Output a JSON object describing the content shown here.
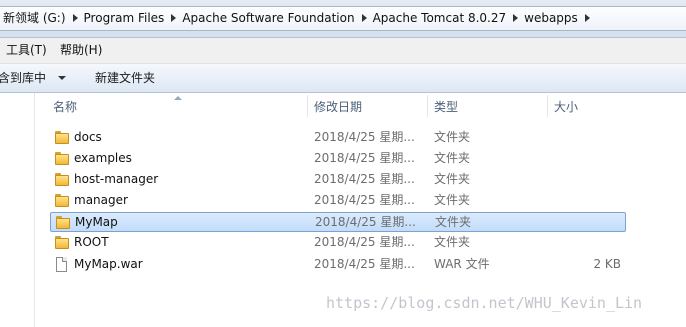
{
  "address": {
    "crumbs": [
      "新领域 (G:)",
      "Program Files",
      "Apache Software Foundation",
      "Apache Tomcat 8.0.27",
      "webapps"
    ]
  },
  "menu": {
    "tools": "工具(T)",
    "help": "帮助(H)"
  },
  "toolbar": {
    "include_library": "包含到库中",
    "new_folder": "新建文件夹"
  },
  "columns": {
    "name": "名称",
    "date": "修改日期",
    "type": "类型",
    "size": "大小"
  },
  "files": [
    {
      "name": "docs",
      "date": "2018/4/25 星期...",
      "type": "文件夹",
      "size": "",
      "icon": "folder-icon"
    },
    {
      "name": "examples",
      "date": "2018/4/25 星期...",
      "type": "文件夹",
      "size": "",
      "icon": "folder-icon"
    },
    {
      "name": "host-manager",
      "date": "2018/4/25 星期...",
      "type": "文件夹",
      "size": "",
      "icon": "folder-icon"
    },
    {
      "name": "manager",
      "date": "2018/4/25 星期...",
      "type": "文件夹",
      "size": "",
      "icon": "folder-icon"
    },
    {
      "name": "MyMap",
      "date": "2018/4/25 星期...",
      "type": "文件夹",
      "size": "",
      "icon": "folder-icon",
      "selected": true
    },
    {
      "name": "ROOT",
      "date": "2018/4/25 星期...",
      "type": "文件夹",
      "size": "",
      "icon": "folder-icon"
    },
    {
      "name": "MyMap.war",
      "date": "2018/4/25 星期...",
      "type": "WAR 文件",
      "size": "2 KB",
      "icon": "file-icon"
    }
  ],
  "watermark": "https://blog.csdn.net/WHU_Kevin_Lin",
  "colors": {
    "selection": "#cce4fc",
    "selection_border": "#7da2ce",
    "folder": "#f0b93a",
    "header_text": "#4c607a"
  }
}
